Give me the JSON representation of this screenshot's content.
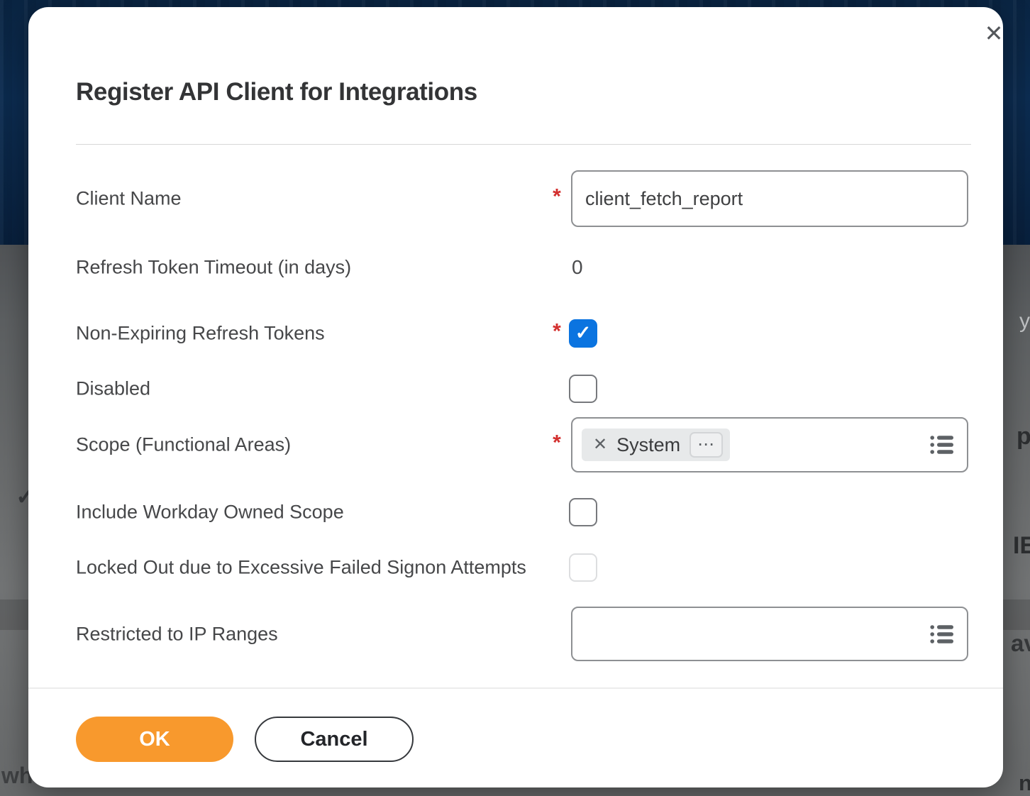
{
  "dialog": {
    "title": "Register API Client for Integrations",
    "required_marker": "*",
    "close_icon": "✕",
    "fields": {
      "client_name": {
        "label": "Client Name",
        "required": true,
        "value": "client_fetch_report"
      },
      "refresh_token_timeout": {
        "label": "Refresh Token Timeout (in days)",
        "value": "0"
      },
      "non_expiring_refresh_tokens": {
        "label": "Non-Expiring Refresh Tokens",
        "required": true,
        "checked": true,
        "check_glyph": "✓"
      },
      "disabled": {
        "label": "Disabled",
        "checked": false
      },
      "scope": {
        "label": "Scope (Functional Areas)",
        "required": true,
        "selected_tag": "System",
        "remove_icon": "✕",
        "more_icon": "⋯"
      },
      "include_workday_owned_scope": {
        "label": "Include Workday Owned Scope",
        "checked": false
      },
      "locked_out": {
        "label": "Locked Out due to Excessive Failed Signon Attempts",
        "checked": false,
        "disabled": true
      },
      "restricted_to_ip_ranges": {
        "label": "Restricted to IP Ranges",
        "value": ""
      }
    },
    "buttons": {
      "ok": "OK",
      "cancel": "Cancel"
    },
    "colors": {
      "accent_orange": "#f8992d",
      "checkbox_blue": "#0b74e0",
      "required_red": "#d3302f",
      "header_navy": "#0b2c51",
      "scrim_gray": "#6a6c6d"
    }
  },
  "backdrop_fragments": {
    "wh": "wh",
    "check": "✓",
    "y": "y",
    "p": "p",
    "ie": "IE",
    "av": "av",
    "n": "n"
  }
}
